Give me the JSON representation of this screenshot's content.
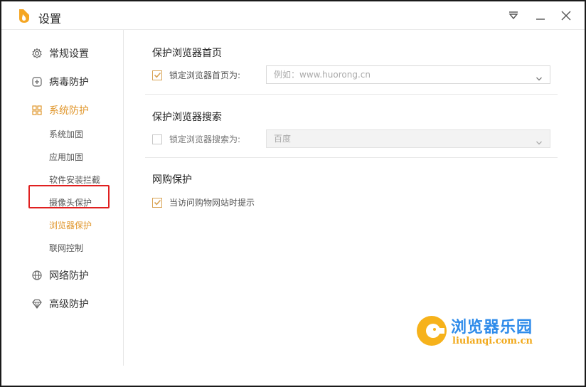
{
  "window": {
    "title": "设置"
  },
  "sidebar": {
    "items": [
      {
        "label": "常规设置",
        "icon": "gear-icon"
      },
      {
        "label": "病毒防护",
        "icon": "plus-box-icon"
      },
      {
        "label": "系统防护",
        "icon": "grid-icon",
        "active": true
      },
      {
        "label": "网络防护",
        "icon": "globe-icon"
      },
      {
        "label": "高级防护",
        "icon": "diamond-icon"
      }
    ],
    "subitems": [
      {
        "label": "系统加固"
      },
      {
        "label": "应用加固"
      },
      {
        "label": "软件安装拦截"
      },
      {
        "label": "摄像头保护"
      },
      {
        "label": "浏览器保护",
        "active": true
      },
      {
        "label": "联网控制"
      }
    ]
  },
  "main": {
    "sections": [
      {
        "title": "保护浏览器首页",
        "option_label": "锁定浏览器首页为:",
        "checked": true,
        "select_placeholder": "例如：www.huorong.cn"
      },
      {
        "title": "保护浏览器搜索",
        "option_label": "锁定浏览器搜索为:",
        "checked": false,
        "select_value": "百度"
      },
      {
        "title": "网购保护",
        "option_label": "当访问购物网站时提示",
        "checked": true
      }
    ]
  },
  "watermark": {
    "title": "浏览器乐园",
    "url": "liulanqi.com.cn"
  },
  "colors": {
    "accent": "#e0962b",
    "highlight": "#e02020",
    "watermark_blue": "#2e8bea",
    "watermark_orange": "#f1a91b"
  }
}
